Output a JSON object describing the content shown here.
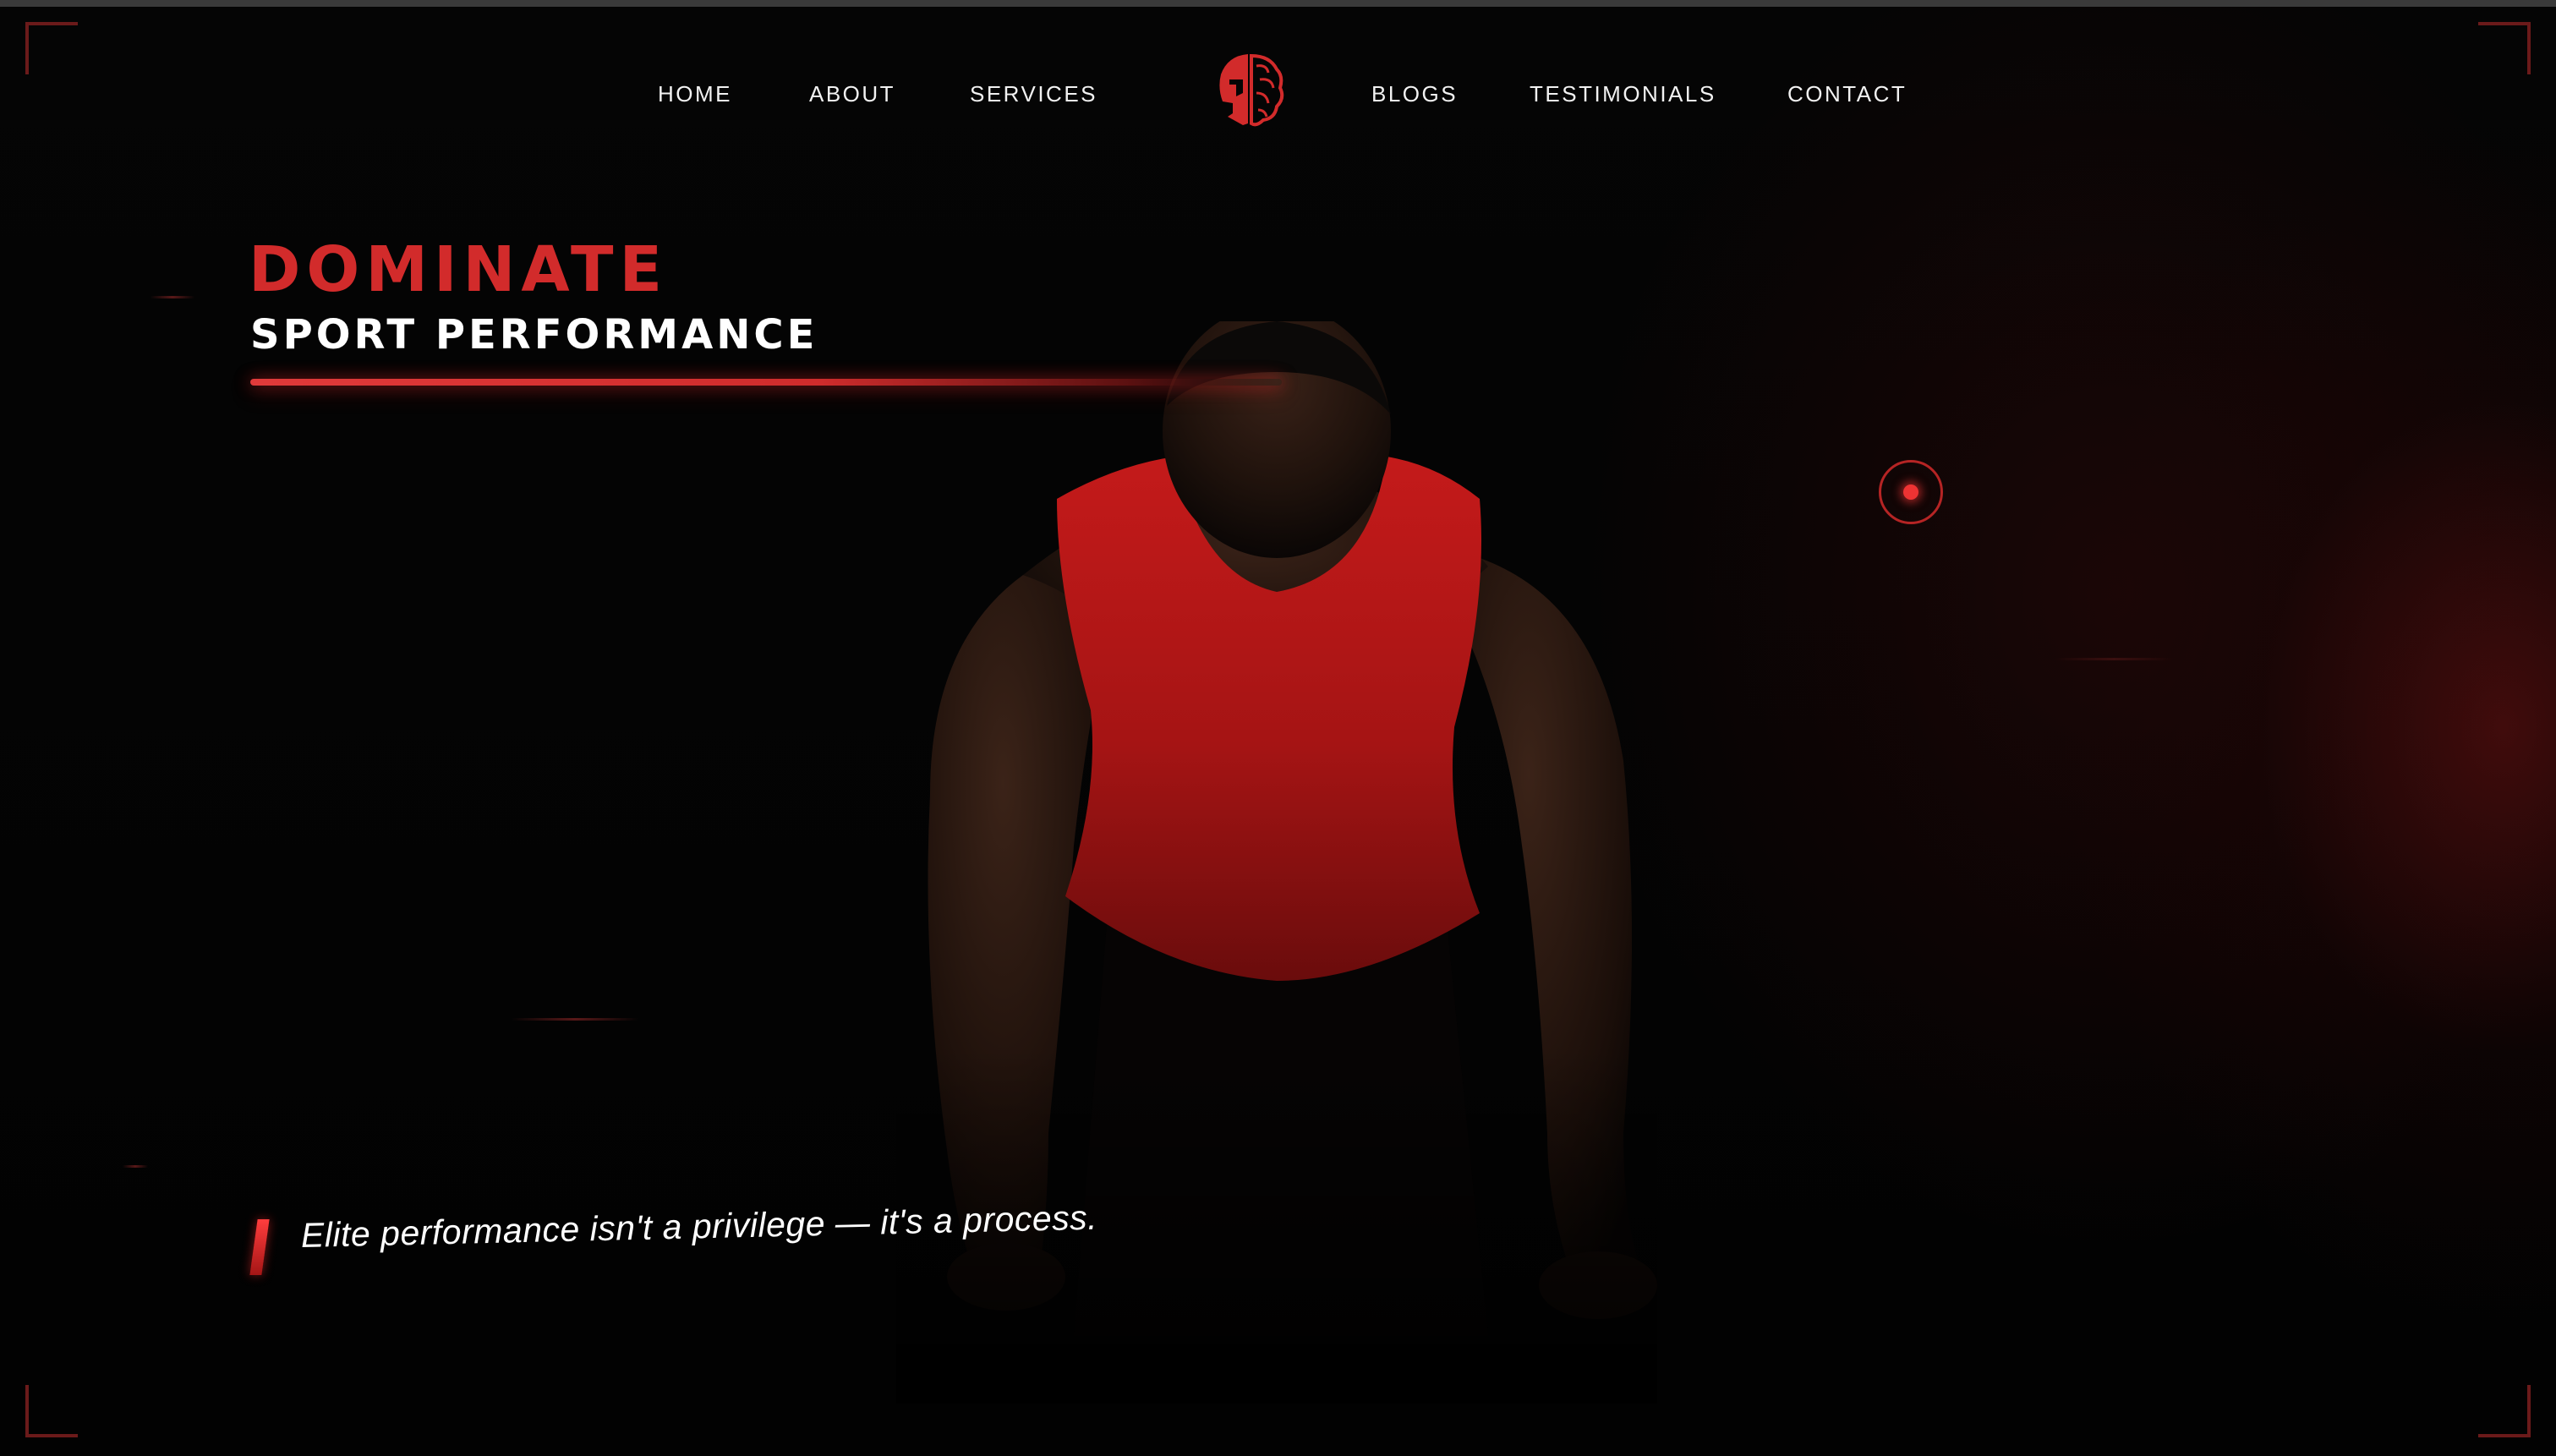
{
  "nav": {
    "items": [
      {
        "label": "HOME"
      },
      {
        "label": "ABOUT"
      },
      {
        "label": "SERVICES"
      },
      {
        "label": "BLOGS"
      },
      {
        "label": "TESTIMONIALS"
      },
      {
        "label": "CONTACT"
      }
    ],
    "logo_icon": "spartan-helmet-brain-icon"
  },
  "hero": {
    "headline": "DOMINATE",
    "subheadline": "SPORT PERFORMANCE",
    "quote": "Elite performance isn't a privilege — it's a process."
  },
  "colors": {
    "accent": "#d22b2b",
    "background": "#050505",
    "text": "#ffffff"
  }
}
